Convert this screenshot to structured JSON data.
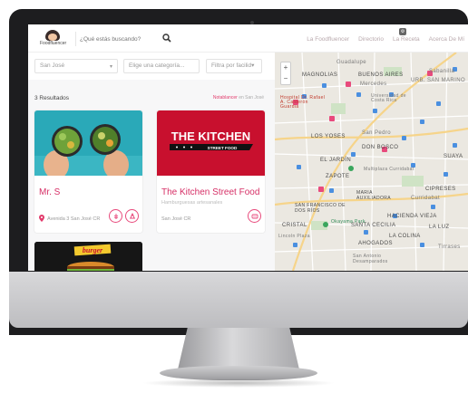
{
  "header": {
    "logo_text": "Foodfluencer",
    "search_placeholder": "¿Qué estás buscando?",
    "nav": [
      "La Foodfluencer",
      "Directorio",
      "La Receta",
      "Acerca De Mí"
    ]
  },
  "filters": {
    "location": "San José",
    "category_placeholder": "Elige una categoría...",
    "filter_placeholder": "Filtra por facilid▾"
  },
  "results": {
    "count_label": "3 Resultados",
    "sort_prefix": "Notablancer",
    "sort_suffix": "en San José"
  },
  "cards": [
    {
      "name": "Mr. S",
      "category": "",
      "location": "Avenida 3 San José CR"
    },
    {
      "name": "The Kitchen Street Food",
      "category": "Hamburguesas artesanales",
      "location": "San José CR",
      "image_title": "THE KITCHEN",
      "image_subtitle": "STREET FOOD"
    },
    {
      "image_title": "burger"
    }
  ],
  "map": {
    "labels": [
      {
        "text": "MAGNOLIAS"
      },
      {
        "text": "Guadalupe"
      },
      {
        "text": "BUENOS AIRES"
      },
      {
        "text": "Mercedes"
      },
      {
        "text": "URB. SAN MARINO"
      },
      {
        "text": "Sabanilla"
      },
      {
        "text": "Universidad de Costa Rica"
      },
      {
        "text": "Hospital Dr. Rafael A. Calderón Guardia"
      },
      {
        "text": "LOS YOSES"
      },
      {
        "text": "San Pedro"
      },
      {
        "text": "DON BOSCO"
      },
      {
        "text": "EL JARDÍN"
      },
      {
        "text": "SUAYA"
      },
      {
        "text": "ZAPOTE"
      },
      {
        "text": "Multiplaza Curridabat"
      },
      {
        "text": "CIPRESES"
      },
      {
        "text": "MARIA AUXILIADORA"
      },
      {
        "text": "Curridabat"
      },
      {
        "text": "SAN FRANCISCO DE DOS RÍOS"
      },
      {
        "text": "HACIENDA VIEJA"
      },
      {
        "text": "SANTA CECILIA"
      },
      {
        "text": "LA LUZ"
      },
      {
        "text": "LA COLINA"
      },
      {
        "text": "AHOGADOS"
      },
      {
        "text": "Tirrases"
      },
      {
        "text": "San Antonio Desamparados"
      },
      {
        "text": "Lincoln Plaza"
      },
      {
        "text": "Okayama Park"
      },
      {
        "text": "CRISTAL"
      }
    ]
  },
  "colors": {
    "accent": "#e23b6c",
    "card_name": "#d62f66",
    "map_pin": "#e84a7c"
  }
}
